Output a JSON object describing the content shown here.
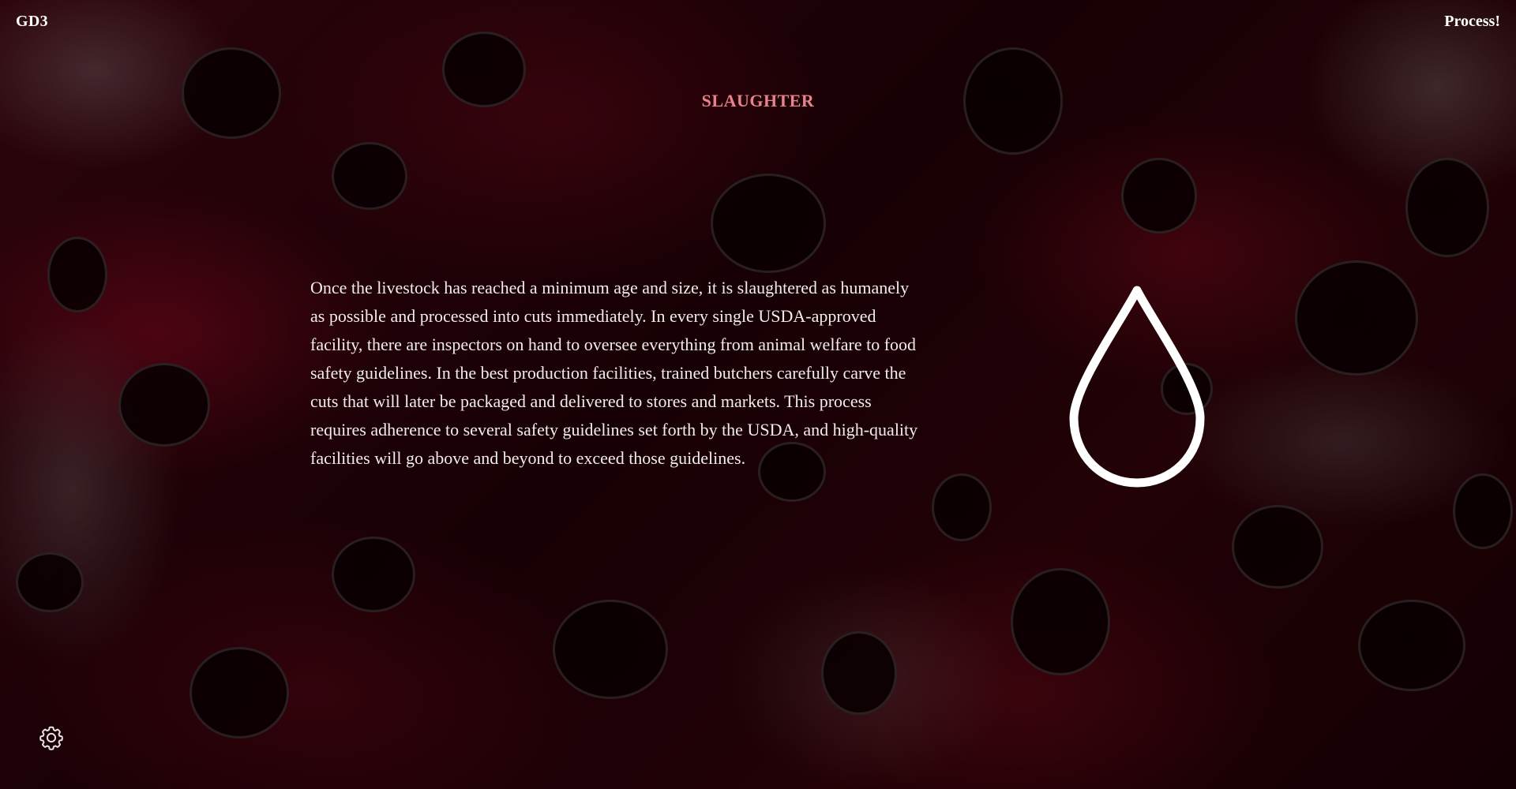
{
  "header": {
    "brand": "GD3",
    "nav_link": "Process!"
  },
  "section": {
    "title": "SLAUGHTER",
    "body": "Once the livestock has reached a minimum age and size, it is slaughtered as humanely as possible and processed into cuts immediately. In every single USDA-approved facility, there are inspectors on hand to oversee everything from animal welfare to food safety guidelines. In the best production facilities, trained butchers carefully carve the cuts that will later be packaged and delivered to stores and markets. This process requires adherence to several safety guidelines set forth by the USDA, and high-quality facilities will go above and beyond to exceed those guidelines.",
    "illustration_icon": "blood-drop-icon"
  },
  "footer": {
    "settings_icon": "gear-icon"
  },
  "colors": {
    "title_accent": "#e8838d",
    "background": "#1c0307",
    "text": "#ffffff"
  }
}
